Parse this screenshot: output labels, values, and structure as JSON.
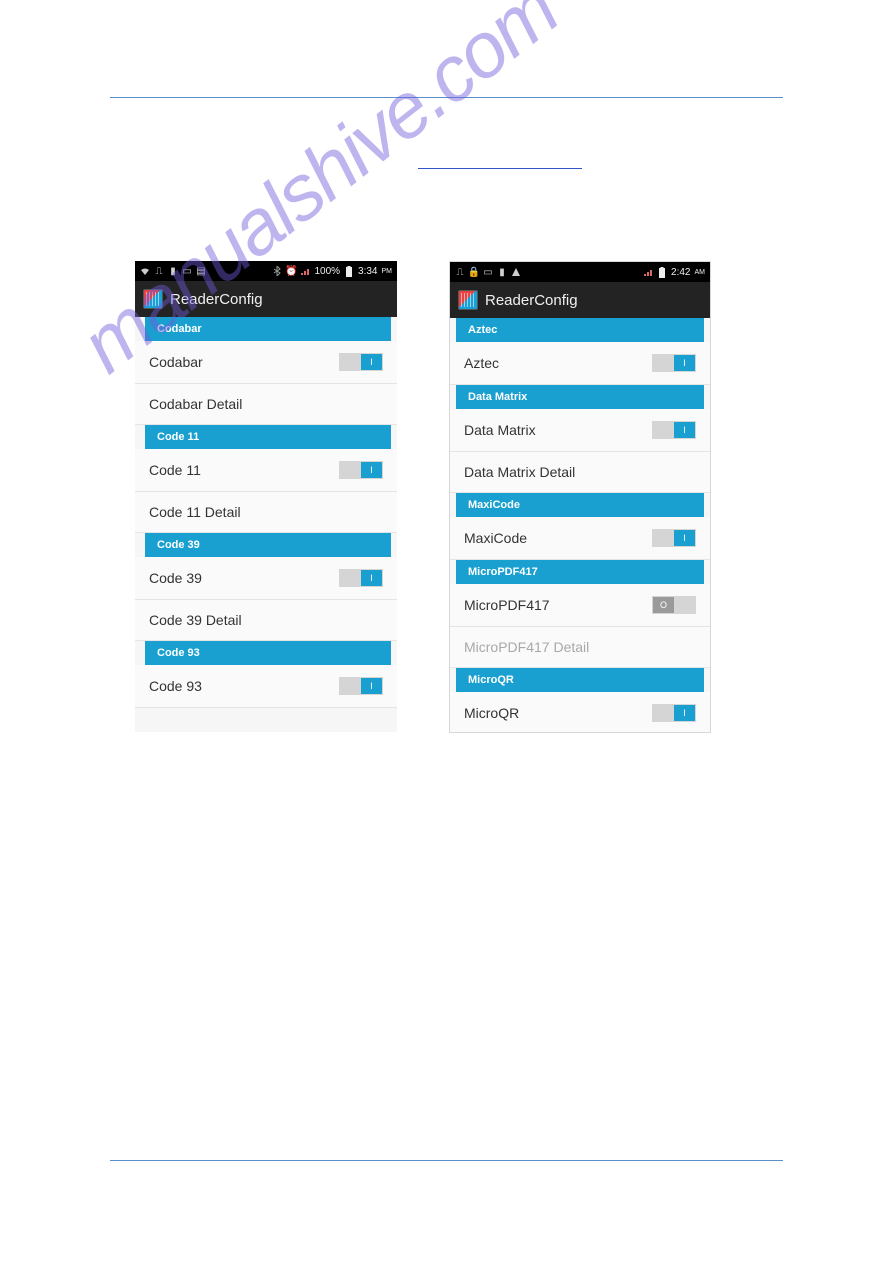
{
  "watermark": "manualshive.com",
  "left": {
    "statusbar": {
      "battery_text": "100%",
      "time": "3:34",
      "ampm": "PM"
    },
    "appbar": {
      "title": "ReaderConfig"
    },
    "sections": [
      {
        "header": "Codabar",
        "rows": [
          {
            "label": "Codabar",
            "toggle": "on"
          },
          {
            "label": "Codabar Detail"
          }
        ]
      },
      {
        "header": "Code 11",
        "rows": [
          {
            "label": "Code 11",
            "toggle": "on"
          },
          {
            "label": "Code 11 Detail"
          }
        ]
      },
      {
        "header": "Code 39",
        "rows": [
          {
            "label": "Code 39",
            "toggle": "on"
          },
          {
            "label": "Code 39 Detail"
          }
        ]
      },
      {
        "header": "Code 93",
        "rows": [
          {
            "label": "Code 93",
            "toggle": "on"
          }
        ]
      }
    ]
  },
  "right": {
    "statusbar": {
      "time": "2:42",
      "ampm": "AM"
    },
    "appbar": {
      "title": "ReaderConfig"
    },
    "sections": [
      {
        "header": "Aztec",
        "rows": [
          {
            "label": "Aztec",
            "toggle": "on"
          }
        ]
      },
      {
        "header": "Data Matrix",
        "rows": [
          {
            "label": "Data Matrix",
            "toggle": "on"
          },
          {
            "label": "Data Matrix Detail"
          }
        ]
      },
      {
        "header": "MaxiCode",
        "rows": [
          {
            "label": "MaxiCode",
            "toggle": "on"
          }
        ]
      },
      {
        "header": "MicroPDF417",
        "rows": [
          {
            "label": "MicroPDF417",
            "toggle": "off"
          },
          {
            "label": "MicroPDF417 Detail",
            "disabled": true
          }
        ]
      },
      {
        "header": "MicroQR",
        "rows": [
          {
            "label": "MicroQR",
            "toggle": "on"
          }
        ]
      }
    ]
  }
}
